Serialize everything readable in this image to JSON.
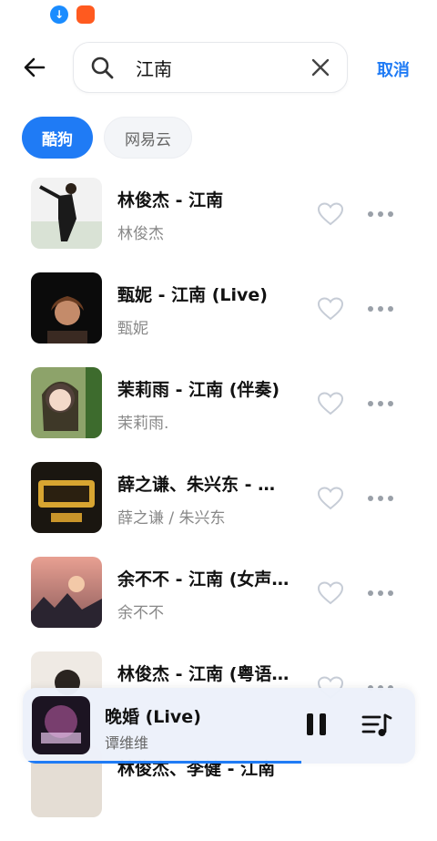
{
  "status_bar": {
    "icons": [
      "download-icon",
      "app-notification-icon"
    ]
  },
  "header": {
    "back_icon": "arrow-left-icon",
    "search": {
      "value": "江南",
      "icon": "search-icon",
      "clear_icon": "close-icon"
    },
    "cancel_label": "取消"
  },
  "tabs": [
    {
      "label": "酷狗",
      "active": true
    },
    {
      "label": "网易云",
      "active": false
    }
  ],
  "songs": [
    {
      "title": "林俊杰 - 江南",
      "artist": "林俊杰"
    },
    {
      "title": "甄妮 - 江南 (Live)",
      "artist": "甄妮"
    },
    {
      "title": "茉莉雨 - 江南 (伴奏)",
      "artist": "茉莉雨."
    },
    {
      "title": "薛之谦、朱兴东 - 江南",
      "artist": "薛之谦 / 朱兴东"
    },
    {
      "title": "余不不 - 江南 (女声版)",
      "artist": "余不不"
    },
    {
      "title": "林俊杰 - 江南 (粤语版)",
      "artist": ""
    },
    {
      "title": "林俊杰、李健 - 江南",
      "artist": ""
    }
  ],
  "player": {
    "title": "晚婚 (Live)",
    "artist": "谭维维",
    "progress": 0.71
  },
  "colors": {
    "accent": "#1f7bf5",
    "text_primary": "#111111",
    "text_secondary": "#888888"
  }
}
